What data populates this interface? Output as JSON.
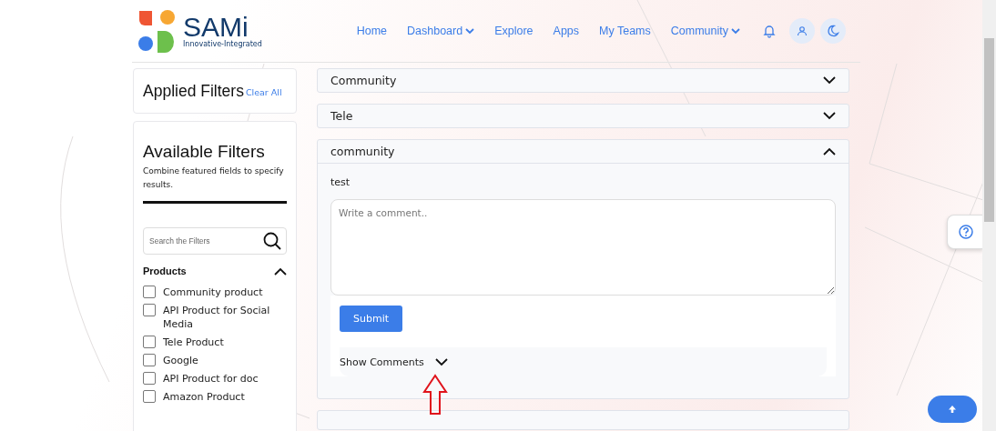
{
  "header": {
    "logo_text": "SAMi",
    "logo_tagline": "Innovative-Integrated",
    "nav": [
      {
        "label": "Home",
        "dropdown": false
      },
      {
        "label": "Dashboard",
        "dropdown": true
      },
      {
        "label": "Explore",
        "dropdown": false
      },
      {
        "label": "Apps",
        "dropdown": false
      },
      {
        "label": "My Teams",
        "dropdown": false
      },
      {
        "label": "Community",
        "dropdown": true
      }
    ]
  },
  "applied_filters": {
    "title": "Applied Filters",
    "clear_link": "Clear All"
  },
  "available_filters": {
    "title": "Available Filters",
    "description": "Combine featured fields to specify results.",
    "search": {
      "placeholder": "Search the Filters"
    },
    "groups": [
      {
        "title": "Products",
        "expanded": true,
        "options": [
          {
            "label": "Community product",
            "checked": false
          },
          {
            "label": "API Product for Social Media",
            "checked": false
          },
          {
            "label": "Tele Product",
            "checked": false
          },
          {
            "label": "Google",
            "checked": false
          },
          {
            "label": "API Product for doc",
            "checked": false
          },
          {
            "label": "Amazon Product",
            "checked": false
          }
        ]
      }
    ]
  },
  "accordions": [
    {
      "title": "Community",
      "expanded": false
    },
    {
      "title": "Tele",
      "expanded": false
    },
    {
      "title": "community",
      "expanded": true,
      "body": "test",
      "comment": {
        "placeholder": "Write a comment.."
      },
      "submit": "Submit",
      "show_comments": "Show Comments"
    }
  ]
}
